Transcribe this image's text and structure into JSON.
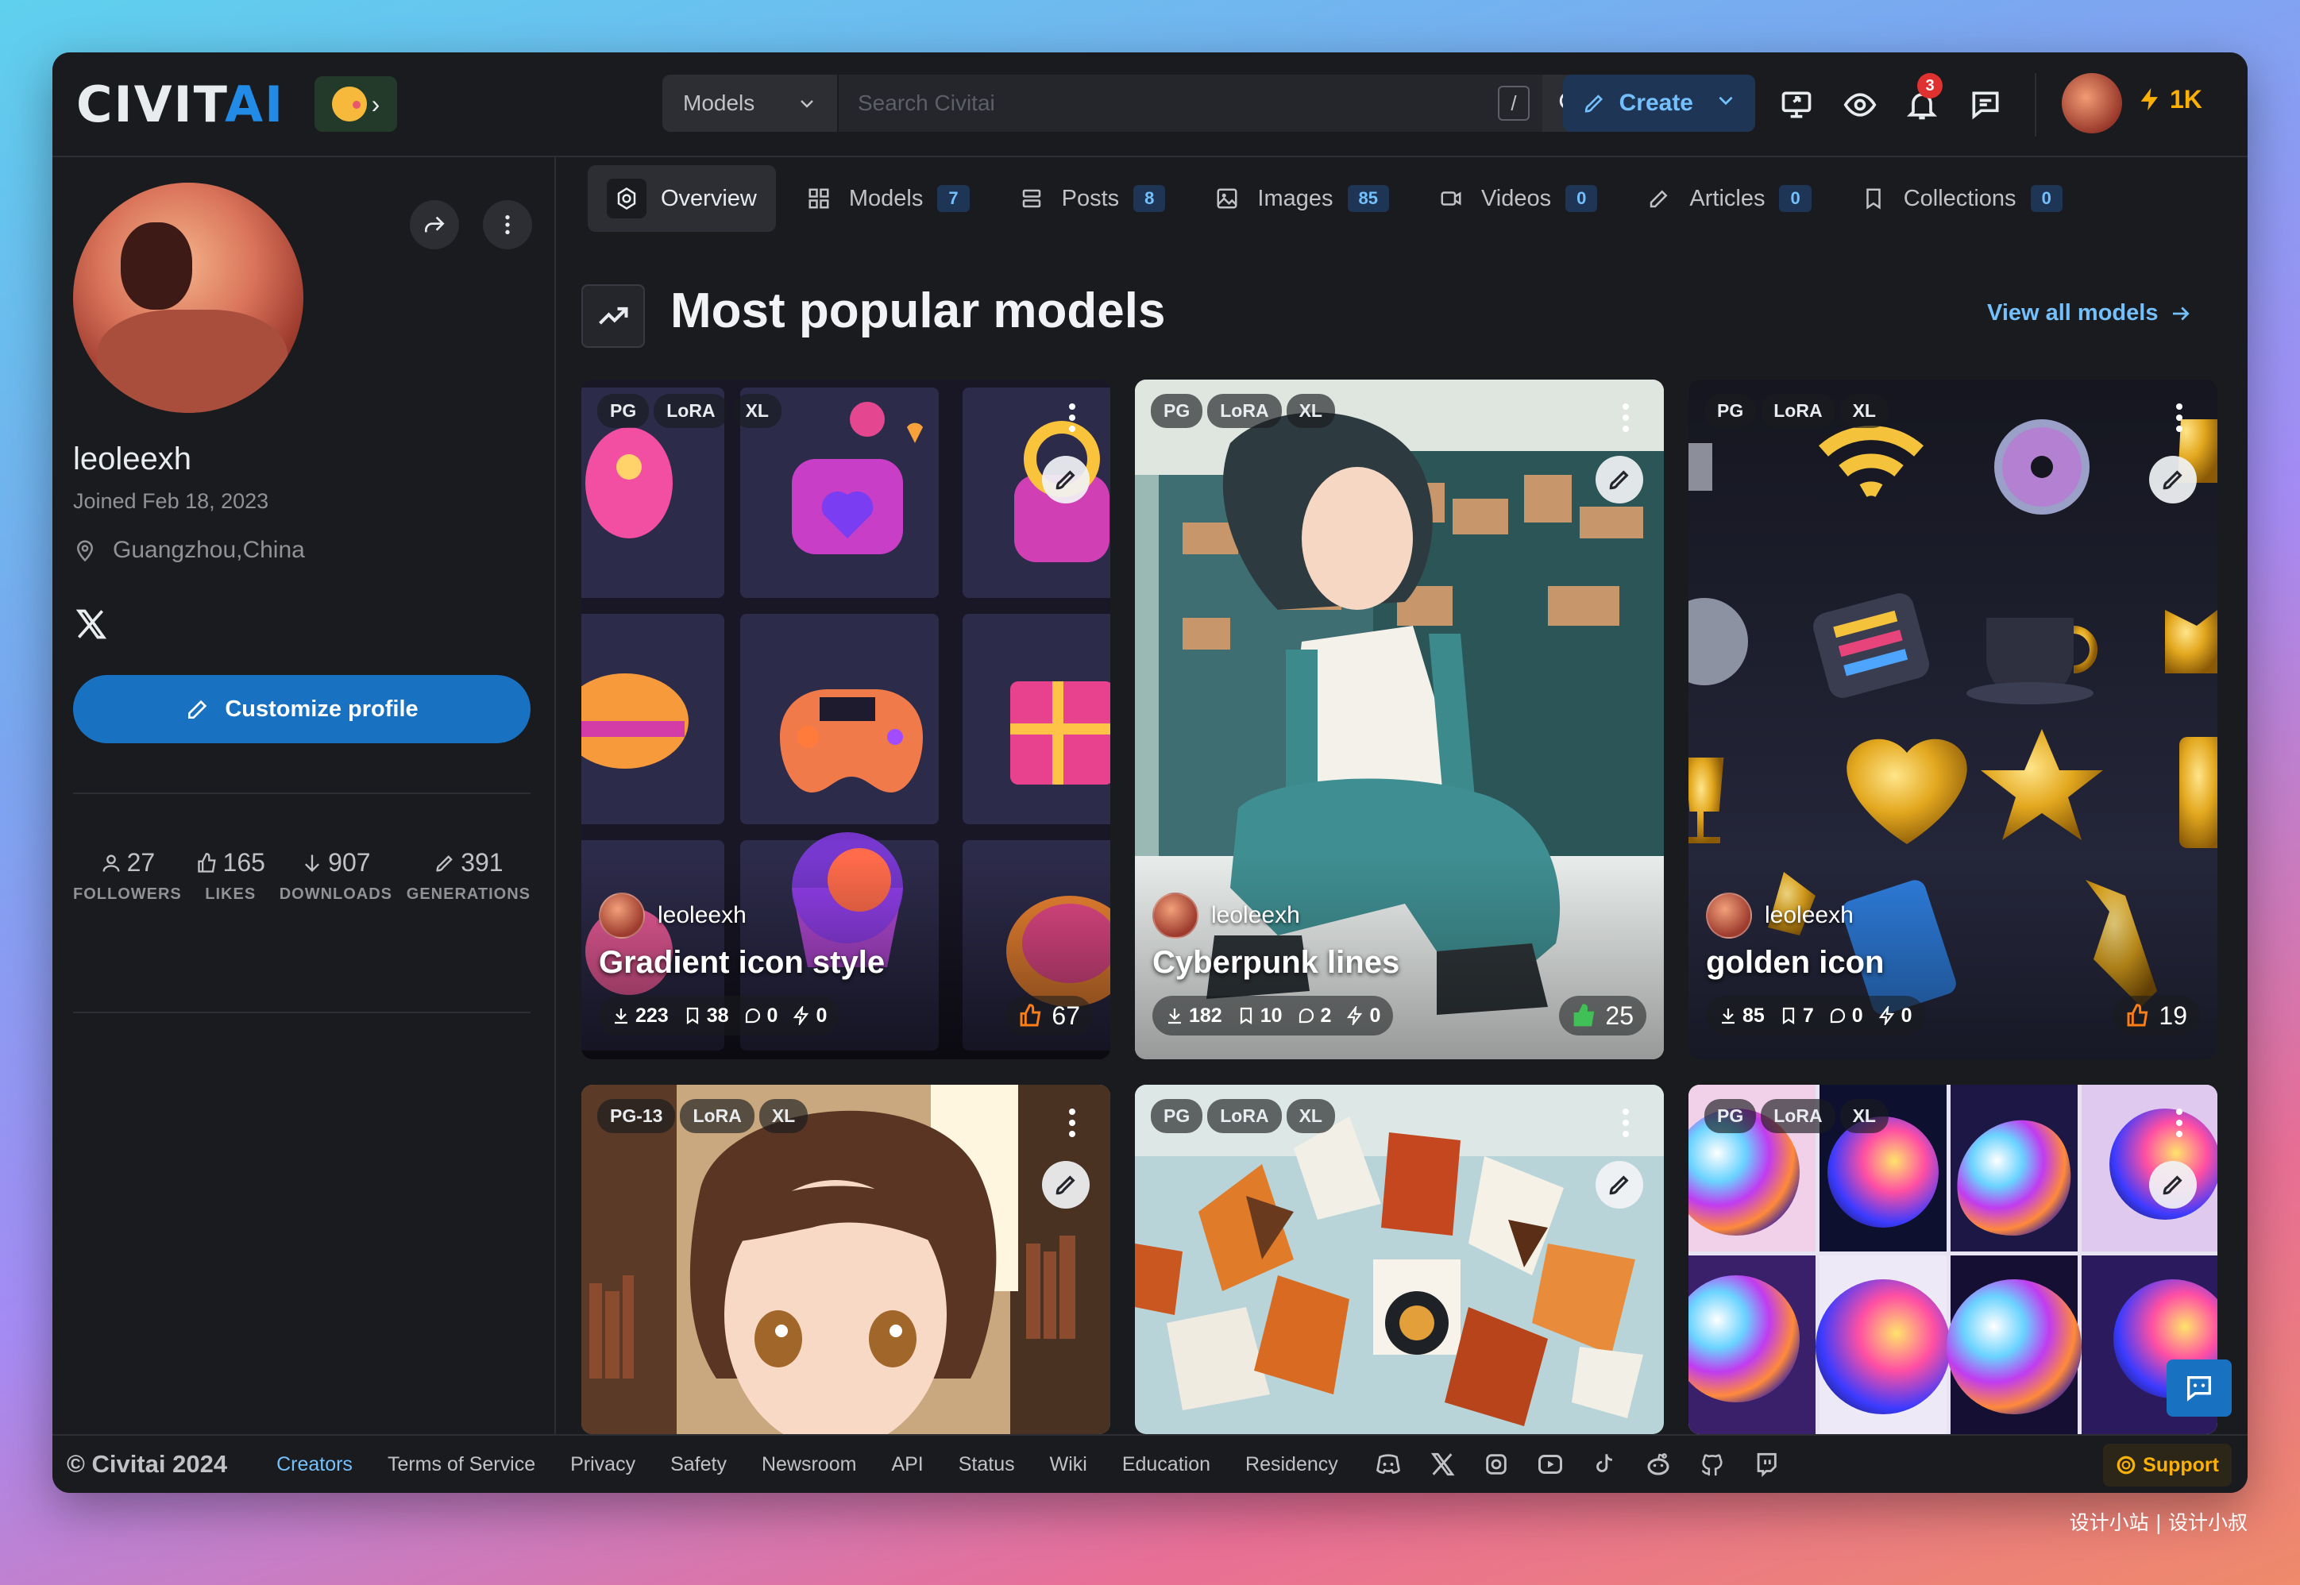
{
  "header": {
    "logo_part1": "CIVIT",
    "logo_part2": "AI",
    "search_type": "Models",
    "search_placeholder": "Search Civitai",
    "search_shortcut": "/",
    "create_label": "Create",
    "notification_count": "3",
    "buzz_amount": "1K"
  },
  "profile": {
    "username": "leoleexh",
    "joined": "Joined Feb 18, 2023",
    "location": "Guangzhou,China",
    "customize_label": "Customize profile",
    "stats": [
      {
        "value": "27",
        "label": "FOLLOWERS",
        "icon": "user-icon"
      },
      {
        "value": "165",
        "label": "LIKES",
        "icon": "thumb-up-icon"
      },
      {
        "value": "907",
        "label": "DOWNLOADS",
        "icon": "arrow-down-icon"
      },
      {
        "value": "391",
        "label": "GENERATIONS",
        "icon": "brush-icon"
      }
    ]
  },
  "tabs": [
    {
      "label": "Overview",
      "count": "",
      "icon": "overview-icon"
    },
    {
      "label": "Models",
      "count": "7",
      "icon": "grid-icon"
    },
    {
      "label": "Posts",
      "count": "8",
      "icon": "layers-icon"
    },
    {
      "label": "Images",
      "count": "85",
      "icon": "image-icon"
    },
    {
      "label": "Videos",
      "count": "0",
      "icon": "video-icon"
    },
    {
      "label": "Articles",
      "count": "0",
      "icon": "pencil-icon"
    },
    {
      "label": "Collections",
      "count": "0",
      "icon": "bookmark-icon"
    }
  ],
  "section": {
    "title": "Most popular models",
    "view_all": "View all models"
  },
  "cards": [
    {
      "rating": "PG",
      "type": "LoRA",
      "base": "XL",
      "owner": "leoleexh",
      "name": "Gradient icon style",
      "downloads": "223",
      "collected": "38",
      "comments": "0",
      "tips": "0",
      "likes": "67"
    },
    {
      "rating": "PG",
      "type": "LoRA",
      "base": "XL",
      "owner": "leoleexh",
      "name": "Cyberpunk lines",
      "downloads": "182",
      "collected": "10",
      "comments": "2",
      "tips": "0",
      "likes": "25"
    },
    {
      "rating": "PG",
      "type": "LoRA",
      "base": "XL",
      "owner": "leoleexh",
      "name": "golden icon",
      "downloads": "85",
      "collected": "7",
      "comments": "0",
      "tips": "0",
      "likes": "19"
    },
    {
      "rating": "PG-13",
      "type": "LoRA",
      "base": "XL"
    },
    {
      "rating": "PG",
      "type": "LoRA",
      "base": "XL"
    },
    {
      "rating": "PG",
      "type": "LoRA",
      "base": "XL"
    }
  ],
  "footer": {
    "copyright": "© Civitai 2024",
    "links": [
      "Creators",
      "Terms of Service",
      "Privacy",
      "Safety",
      "Newsroom",
      "API",
      "Status",
      "Wiki",
      "Education",
      "Residency"
    ],
    "support_label": "Support"
  },
  "watermark": "设计小站 | 设计小叔",
  "colors": {
    "accent": "#228be6",
    "primary_button": "#1971c2",
    "badge": "#1e3555",
    "buzz": "#fab005"
  }
}
